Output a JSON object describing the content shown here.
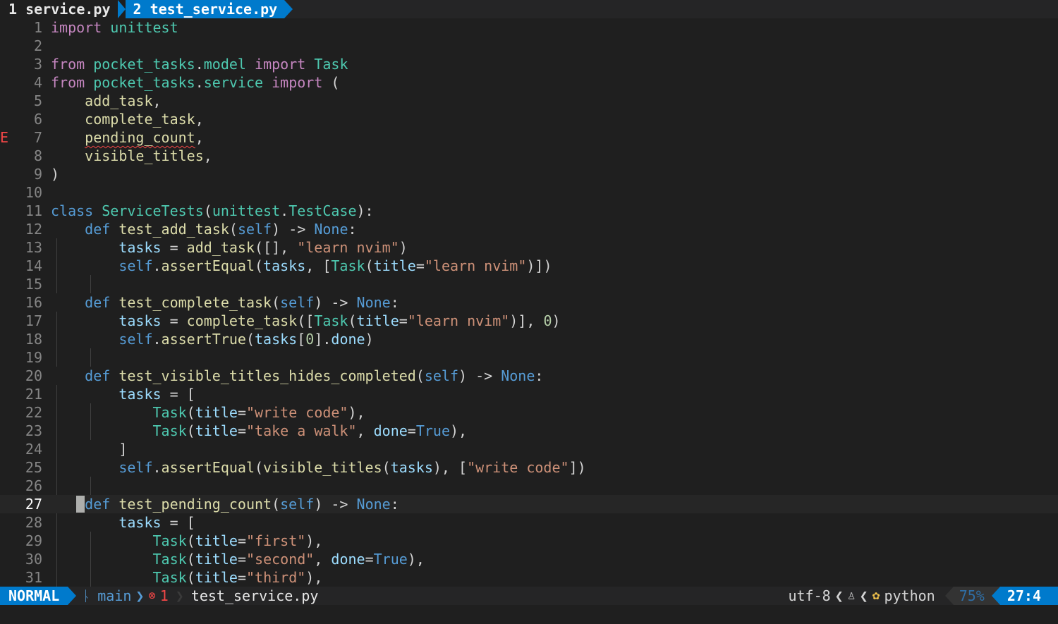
{
  "tabs": [
    {
      "label": "1 service.py",
      "active": false
    },
    {
      "label": "2 test_service.py",
      "active": true
    }
  ],
  "lines": [
    {
      "n": "1",
      "tokens": [
        [
          "kw",
          "import"
        ],
        [
          "plain",
          " "
        ],
        [
          "mod",
          "unittest"
        ]
      ]
    },
    {
      "n": "2",
      "tokens": []
    },
    {
      "n": "3",
      "tokens": [
        [
          "kw",
          "from"
        ],
        [
          "plain",
          " "
        ],
        [
          "mod",
          "pocket_tasks"
        ],
        [
          "plain",
          "."
        ],
        [
          "mod",
          "model"
        ],
        [
          "plain",
          " "
        ],
        [
          "kw",
          "import"
        ],
        [
          "plain",
          " "
        ],
        [
          "cls",
          "Task"
        ]
      ]
    },
    {
      "n": "4",
      "tokens": [
        [
          "kw",
          "from"
        ],
        [
          "plain",
          " "
        ],
        [
          "mod",
          "pocket_tasks"
        ],
        [
          "plain",
          "."
        ],
        [
          "mod",
          "service"
        ],
        [
          "plain",
          " "
        ],
        [
          "kw",
          "import"
        ],
        [
          "plain",
          " ("
        ]
      ]
    },
    {
      "n": "5",
      "tokens": [
        [
          "plain",
          "    "
        ],
        [
          "fn",
          "add_task"
        ],
        [
          "plain",
          ","
        ]
      ]
    },
    {
      "n": "6",
      "tokens": [
        [
          "plain",
          "    "
        ],
        [
          "fn",
          "complete_task"
        ],
        [
          "plain",
          ","
        ]
      ]
    },
    {
      "n": "7",
      "sign": "E",
      "tokens": [
        [
          "plain",
          "    "
        ],
        [
          "err",
          "pending_count"
        ],
        [
          "plain",
          ","
        ]
      ]
    },
    {
      "n": "8",
      "tokens": [
        [
          "plain",
          "    "
        ],
        [
          "fn",
          "visible_titles"
        ],
        [
          "plain",
          ","
        ]
      ]
    },
    {
      "n": "9",
      "tokens": [
        [
          "plain",
          ")"
        ]
      ]
    },
    {
      "n": "10",
      "tokens": []
    },
    {
      "n": "11",
      "tokens": [
        [
          "def",
          "class"
        ],
        [
          "plain",
          " "
        ],
        [
          "cls",
          "ServiceTests"
        ],
        [
          "plain",
          "("
        ],
        [
          "mod",
          "unittest"
        ],
        [
          "plain",
          "."
        ],
        [
          "cls",
          "TestCase"
        ],
        [
          "plain",
          "):"
        ]
      ]
    },
    {
      "n": "12",
      "tokens": [
        [
          "plain",
          "    "
        ],
        [
          "def",
          "def"
        ],
        [
          "plain",
          " "
        ],
        [
          "fn",
          "test_add_task"
        ],
        [
          "plain",
          "("
        ],
        [
          "self",
          "self"
        ],
        [
          "plain",
          ") -> "
        ],
        [
          "def",
          "None"
        ],
        [
          "plain",
          ":"
        ]
      ]
    },
    {
      "n": "13",
      "tokens": [
        [
          "plain",
          "        "
        ],
        [
          "param",
          "tasks"
        ],
        [
          "plain",
          " = "
        ],
        [
          "fn",
          "add_task"
        ],
        [
          "plain",
          "([], "
        ],
        [
          "str",
          "\"learn nvim\""
        ],
        [
          "plain",
          ")"
        ]
      ]
    },
    {
      "n": "14",
      "tokens": [
        [
          "plain",
          "        "
        ],
        [
          "self",
          "self"
        ],
        [
          "plain",
          "."
        ],
        [
          "fn",
          "assertEqual"
        ],
        [
          "plain",
          "("
        ],
        [
          "param",
          "tasks"
        ],
        [
          "plain",
          ", ["
        ],
        [
          "cls",
          "Task"
        ],
        [
          "plain",
          "("
        ],
        [
          "param",
          "title"
        ],
        [
          "plain",
          "="
        ],
        [
          "str",
          "\"learn nvim\""
        ],
        [
          "plain",
          ")])"
        ]
      ]
    },
    {
      "n": "15",
      "tokens": []
    },
    {
      "n": "16",
      "tokens": [
        [
          "plain",
          "    "
        ],
        [
          "def",
          "def"
        ],
        [
          "plain",
          " "
        ],
        [
          "fn",
          "test_complete_task"
        ],
        [
          "plain",
          "("
        ],
        [
          "self",
          "self"
        ],
        [
          "plain",
          ") -> "
        ],
        [
          "def",
          "None"
        ],
        [
          "plain",
          ":"
        ]
      ]
    },
    {
      "n": "17",
      "tokens": [
        [
          "plain",
          "        "
        ],
        [
          "param",
          "tasks"
        ],
        [
          "plain",
          " = "
        ],
        [
          "fn",
          "complete_task"
        ],
        [
          "plain",
          "(["
        ],
        [
          "cls",
          "Task"
        ],
        [
          "plain",
          "("
        ],
        [
          "param",
          "title"
        ],
        [
          "plain",
          "="
        ],
        [
          "str",
          "\"learn nvim\""
        ],
        [
          "plain",
          ")], "
        ],
        [
          "num",
          "0"
        ],
        [
          "plain",
          ")"
        ]
      ]
    },
    {
      "n": "18",
      "tokens": [
        [
          "plain",
          "        "
        ],
        [
          "self",
          "self"
        ],
        [
          "plain",
          "."
        ],
        [
          "fn",
          "assertTrue"
        ],
        [
          "plain",
          "("
        ],
        [
          "param",
          "tasks"
        ],
        [
          "plain",
          "["
        ],
        [
          "num",
          "0"
        ],
        [
          "plain",
          "]."
        ],
        [
          "param",
          "done"
        ],
        [
          "plain",
          ")"
        ]
      ]
    },
    {
      "n": "19",
      "tokens": []
    },
    {
      "n": "20",
      "tokens": [
        [
          "plain",
          "    "
        ],
        [
          "def",
          "def"
        ],
        [
          "plain",
          " "
        ],
        [
          "fn",
          "test_visible_titles_hides_completed"
        ],
        [
          "plain",
          "("
        ],
        [
          "self",
          "self"
        ],
        [
          "plain",
          ") -> "
        ],
        [
          "def",
          "None"
        ],
        [
          "plain",
          ":"
        ]
      ]
    },
    {
      "n": "21",
      "tokens": [
        [
          "plain",
          "        "
        ],
        [
          "param",
          "tasks"
        ],
        [
          "plain",
          " = ["
        ]
      ]
    },
    {
      "n": "22",
      "tokens": [
        [
          "plain",
          "            "
        ],
        [
          "cls",
          "Task"
        ],
        [
          "plain",
          "("
        ],
        [
          "param",
          "title"
        ],
        [
          "plain",
          "="
        ],
        [
          "str",
          "\"write code\""
        ],
        [
          "plain",
          "),"
        ]
      ]
    },
    {
      "n": "23",
      "tokens": [
        [
          "plain",
          "            "
        ],
        [
          "cls",
          "Task"
        ],
        [
          "plain",
          "("
        ],
        [
          "param",
          "title"
        ],
        [
          "plain",
          "="
        ],
        [
          "str",
          "\"take a walk\""
        ],
        [
          "plain",
          ", "
        ],
        [
          "param",
          "done"
        ],
        [
          "plain",
          "="
        ],
        [
          "def",
          "True"
        ],
        [
          "plain",
          "),"
        ]
      ]
    },
    {
      "n": "24",
      "tokens": [
        [
          "plain",
          "        ]"
        ]
      ]
    },
    {
      "n": "25",
      "tokens": [
        [
          "plain",
          "        "
        ],
        [
          "self",
          "self"
        ],
        [
          "plain",
          "."
        ],
        [
          "fn",
          "assertEqual"
        ],
        [
          "plain",
          "("
        ],
        [
          "fn",
          "visible_titles"
        ],
        [
          "plain",
          "("
        ],
        [
          "param",
          "tasks"
        ],
        [
          "plain",
          "), ["
        ],
        [
          "str",
          "\"write code\""
        ],
        [
          "plain",
          "])"
        ]
      ]
    },
    {
      "n": "26",
      "tokens": []
    },
    {
      "n": "27",
      "current": true,
      "tokens": [
        [
          "plain",
          "    "
        ],
        [
          "def",
          "def"
        ],
        [
          "plain",
          " "
        ],
        [
          "fn",
          "test_pending_count"
        ],
        [
          "plain",
          "("
        ],
        [
          "self",
          "self"
        ],
        [
          "plain",
          ") -> "
        ],
        [
          "def",
          "None"
        ],
        [
          "plain",
          ":"
        ]
      ]
    },
    {
      "n": "28",
      "tokens": [
        [
          "plain",
          "        "
        ],
        [
          "param",
          "tasks"
        ],
        [
          "plain",
          " = ["
        ]
      ]
    },
    {
      "n": "29",
      "tokens": [
        [
          "plain",
          "            "
        ],
        [
          "cls",
          "Task"
        ],
        [
          "plain",
          "("
        ],
        [
          "param",
          "title"
        ],
        [
          "plain",
          "="
        ],
        [
          "str",
          "\"first\""
        ],
        [
          "plain",
          "),"
        ]
      ]
    },
    {
      "n": "30",
      "tokens": [
        [
          "plain",
          "            "
        ],
        [
          "cls",
          "Task"
        ],
        [
          "plain",
          "("
        ],
        [
          "param",
          "title"
        ],
        [
          "plain",
          "="
        ],
        [
          "str",
          "\"second\""
        ],
        [
          "plain",
          ", "
        ],
        [
          "param",
          "done"
        ],
        [
          "plain",
          "="
        ],
        [
          "def",
          "True"
        ],
        [
          "plain",
          "),"
        ]
      ]
    },
    {
      "n": "31",
      "tokens": [
        [
          "plain",
          "            "
        ],
        [
          "cls",
          "Task"
        ],
        [
          "plain",
          "("
        ],
        [
          "param",
          "title"
        ],
        [
          "plain",
          "="
        ],
        [
          "str",
          "\"third\""
        ],
        [
          "plain",
          "),"
        ]
      ]
    }
  ],
  "statusline": {
    "mode": "NORMAL",
    "branch_icon": "git-branch-icon",
    "branch": "main",
    "diagnostics_icon": "error-circle-icon",
    "diagnostics_count": "1",
    "filename": "test_service.py",
    "encoding": "utf-8",
    "os_icon": "linux-tux-icon",
    "filetype_icon": "python-icon",
    "filetype": "python",
    "percent": "75%",
    "position": "27:4"
  },
  "colors": {
    "accent": "#007acc",
    "error": "#f44747",
    "background": "#1f1f1f"
  }
}
